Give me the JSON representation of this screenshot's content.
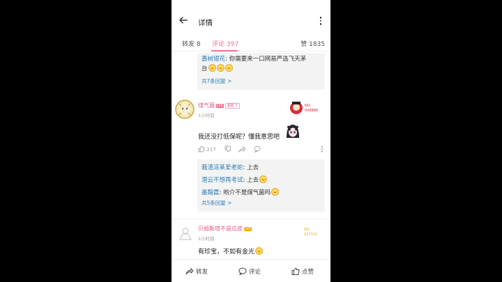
{
  "header": {
    "title": "详情"
  },
  "tabs": [
    {
      "label": "转发 8"
    },
    {
      "label": "评论 397"
    },
    {
      "label": "赞 1835"
    }
  ],
  "reply_block_1": {
    "lines": [
      {
        "user": "嘉树银花",
        "text": ": 你需要来一口网易严选飞天茅",
        "cont": "台"
      }
    ],
    "more": "共7条回复 >"
  },
  "comment_1": {
    "username": "煤气菌",
    "level": "LV6",
    "medal": "超能 3",
    "time": "1小时前",
    "text": "我还没打低保呢？懂我意思吧",
    "pendant_label": "NO. 008886",
    "like_count": "217",
    "replies": [
      {
        "user": "莪渣凉某爱老蛇",
        "text": ": 上去"
      },
      {
        "user": "潜云不想再考试",
        "text": ": 上去"
      },
      {
        "user": "墨黯霆",
        "text": ": 哟介不是煤气菌吗"
      }
    ],
    "more": "共5条回复 >"
  },
  "comment_2": {
    "username": "贝姆斯塔不是瓜皮",
    "level": "LV5",
    "time": "1小时前",
    "text": "有珍宝，不如有金光",
    "pendant_label": "NO. 017331"
  },
  "bottom_bar": {
    "forward": "转发",
    "comment": "评论",
    "like": "点赞"
  },
  "colors": {
    "accent": "#f06c8f",
    "link": "#2e7db3",
    "username": "#e45a85"
  }
}
